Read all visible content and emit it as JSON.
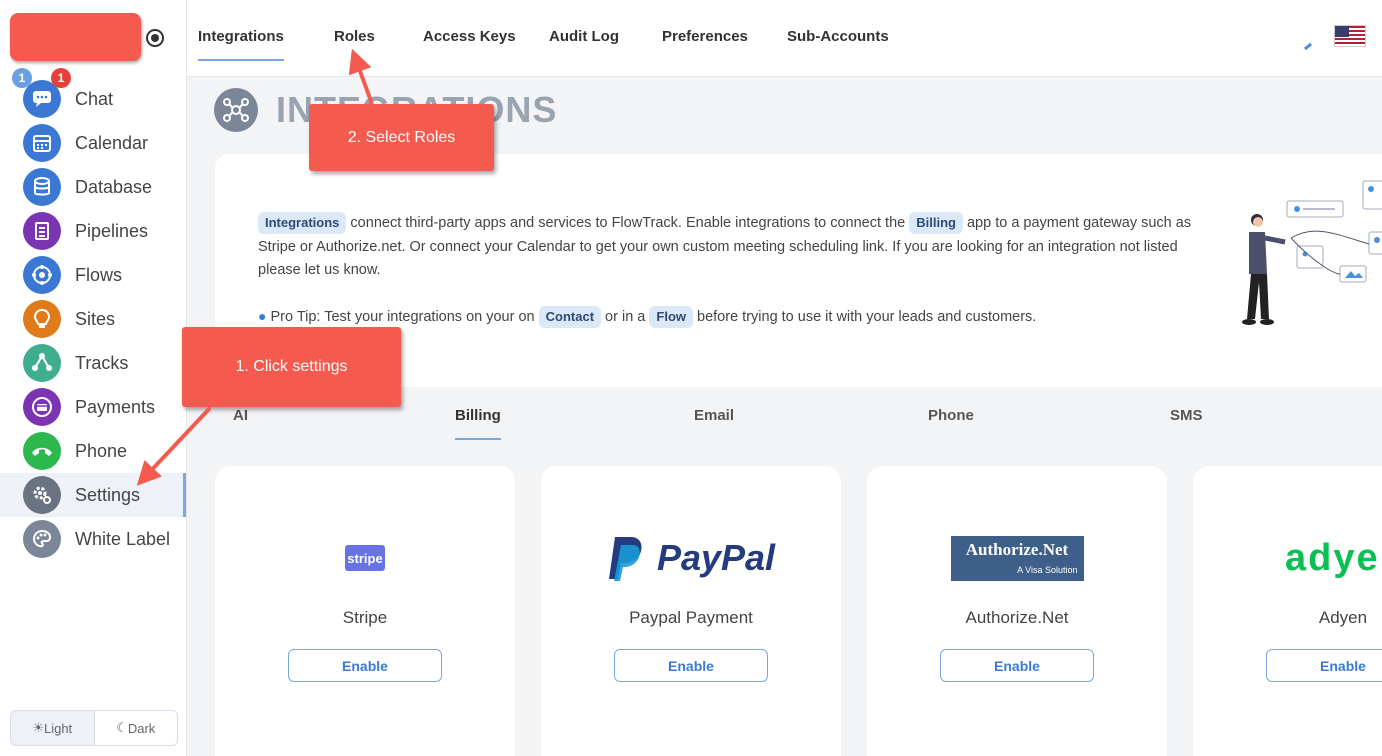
{
  "sidebar": {
    "badges": [
      "1",
      "1"
    ],
    "items": [
      {
        "label": "Chat",
        "icon": "chat-icon",
        "color": "#3a78d4"
      },
      {
        "label": "Calendar",
        "icon": "calendar-icon",
        "color": "#3a78d4"
      },
      {
        "label": "Database",
        "icon": "database-icon",
        "color": "#3a78d4"
      },
      {
        "label": "Pipelines",
        "icon": "pipelines-icon",
        "color": "#7b35b3"
      },
      {
        "label": "Flows",
        "icon": "flows-icon",
        "color": "#3a78d4"
      },
      {
        "label": "Sites",
        "icon": "sites-icon",
        "color": "#e07b1c"
      },
      {
        "label": "Tracks",
        "icon": "tracks-icon",
        "color": "#3fae8f"
      },
      {
        "label": "Payments",
        "icon": "payments-icon",
        "color": "#7b35b3"
      },
      {
        "label": "Phone",
        "icon": "phone-icon",
        "color": "#2db84d"
      },
      {
        "label": "Settings",
        "icon": "settings-icon",
        "color": "#6b7383"
      },
      {
        "label": "White Label",
        "icon": "white-label-icon",
        "color": "#7b8698"
      }
    ],
    "theme": {
      "light": "Light",
      "dark": "Dark"
    }
  },
  "topnav": {
    "tabs": [
      "Integrations",
      "Roles",
      "Access Keys",
      "Audit Log",
      "Preferences",
      "Sub-Accounts"
    ]
  },
  "page": {
    "title": "INTEGRATIONS",
    "intro": {
      "chip1": "Integrations",
      "text1": " connect third-party apps and services to FlowTrack. Enable integrations to connect the ",
      "chip2": "Billing",
      "text2": " app to a payment gateway such as Stripe or Authorize.net. Or connect your Calendar to get your own custom meeting scheduling link. If you are looking for an integration not listed please let us know."
    },
    "tip": {
      "text1": "Pro Tip: Test your integrations on your on ",
      "chip1": "Contact",
      "text2": " or in a ",
      "chip2": "Flow",
      "text3": " before trying to use it with your leads and customers."
    }
  },
  "subtabs": [
    "AI",
    "Billing",
    "Email",
    "Phone",
    "SMS"
  ],
  "cards": [
    {
      "name": "Stripe",
      "logo": "stripe",
      "button": "Enable"
    },
    {
      "name": "Paypal Payment",
      "logo": "PayPal",
      "button": "Enable"
    },
    {
      "name": "Authorize.Net",
      "logo": "Authorize.Net",
      "logo_sub": "A Visa Solution",
      "button": "Enable"
    },
    {
      "name": "Adyen",
      "logo": "adyen",
      "button": "Enable"
    }
  ],
  "annotations": {
    "step1": "1. Click settings",
    "step2": "2. Select Roles"
  },
  "colors": {
    "accent": "#7aa7e0",
    "callout": "#f55a4e",
    "chip_bg": "#dbe8f8"
  }
}
